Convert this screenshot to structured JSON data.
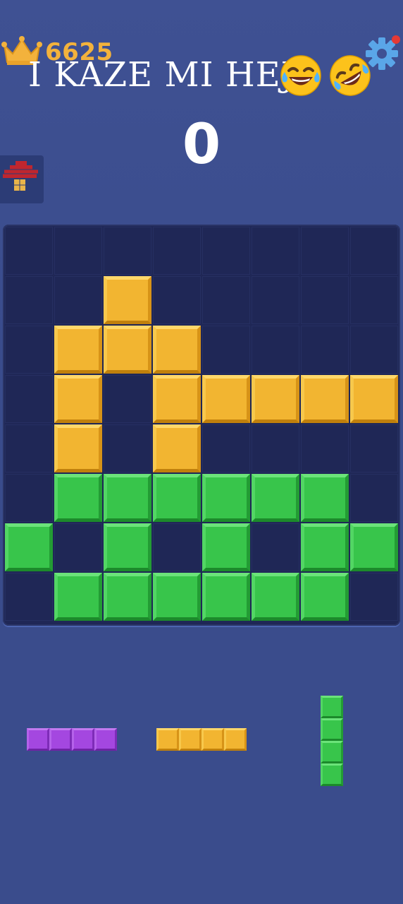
{
  "header": {
    "best_score": "6625",
    "overlay_caption": "I KAZE MI HEJ",
    "emojis": [
      "tears-of-joy-emoji",
      "rolling-on-floor-laughing-emoji"
    ],
    "settings_icon": "gear-icon",
    "crown_icon": "crown-icon",
    "notification_dot_color": "#e53935"
  },
  "score": "0",
  "theme_button": {
    "icon": "mushroom-pixel-icon"
  },
  "board": {
    "rows": 8,
    "cols": 8,
    "cells": [
      [
        ".",
        ".",
        ".",
        ".",
        ".",
        ".",
        ".",
        "."
      ],
      [
        ".",
        ".",
        "Y",
        ".",
        ".",
        ".",
        ".",
        "."
      ],
      [
        ".",
        "Y",
        "Y",
        "Y",
        ".",
        ".",
        ".",
        "."
      ],
      [
        ".",
        "Y",
        ".",
        "Y",
        "Y",
        "Y",
        "Y",
        "Y"
      ],
      [
        ".",
        "Y",
        ".",
        "Y",
        ".",
        ".",
        ".",
        "."
      ],
      [
        ".",
        "G",
        "G",
        "G",
        "G",
        "G",
        "G",
        "."
      ],
      [
        "G",
        ".",
        "G",
        ".",
        "G",
        ".",
        "G",
        "G"
      ],
      [
        ".",
        "G",
        "G",
        "G",
        "G",
        "G",
        "G",
        "."
      ]
    ]
  },
  "tray": [
    {
      "color": "purple",
      "orientation": "horizontal",
      "length": 4
    },
    {
      "color": "gold",
      "orientation": "horizontal",
      "length": 4
    },
    {
      "color": "green",
      "orientation": "vertical",
      "length": 4
    }
  ],
  "colors": {
    "gold": "#f2b531",
    "green": "#38c54b",
    "purple": "#a447e0",
    "board_bg": "#1f2756",
    "background": "#3a4c8c"
  }
}
